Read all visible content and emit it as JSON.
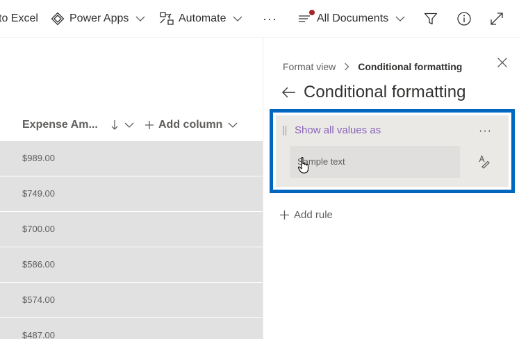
{
  "command_bar": {
    "export_label": "to Excel",
    "power_apps_label": "Power Apps",
    "automate_label": "Automate",
    "more_label": "···",
    "view_label": "All Documents"
  },
  "list": {
    "columns": {
      "expense_amount": "Expense Am...",
      "add_column": "Add column"
    },
    "rows": [
      "$989.00",
      "$749.00",
      "$700.00",
      "$586.00",
      "$574.00",
      "$487.00"
    ]
  },
  "panel": {
    "breadcrumb_parent": "Format view",
    "breadcrumb_current": "Conditional formatting",
    "title": "Conditional formatting",
    "rule": {
      "label": "Show all values as",
      "sample_text": "Sample text",
      "more_label": "···"
    },
    "add_rule_label": "Add rule"
  },
  "colors": {
    "accent_link": "#8764b8",
    "highlight_border": "#0067c0",
    "notification_dot": "#a4262c"
  },
  "icons": [
    "power-apps-icon",
    "automate-icon",
    "view-options-icon",
    "filter-icon",
    "info-icon",
    "expand-icon",
    "sort-descending-icon",
    "close-icon",
    "back-arrow-icon",
    "drag-grip-icon",
    "format-icon",
    "hand-cursor-icon",
    "plus-icon"
  ]
}
